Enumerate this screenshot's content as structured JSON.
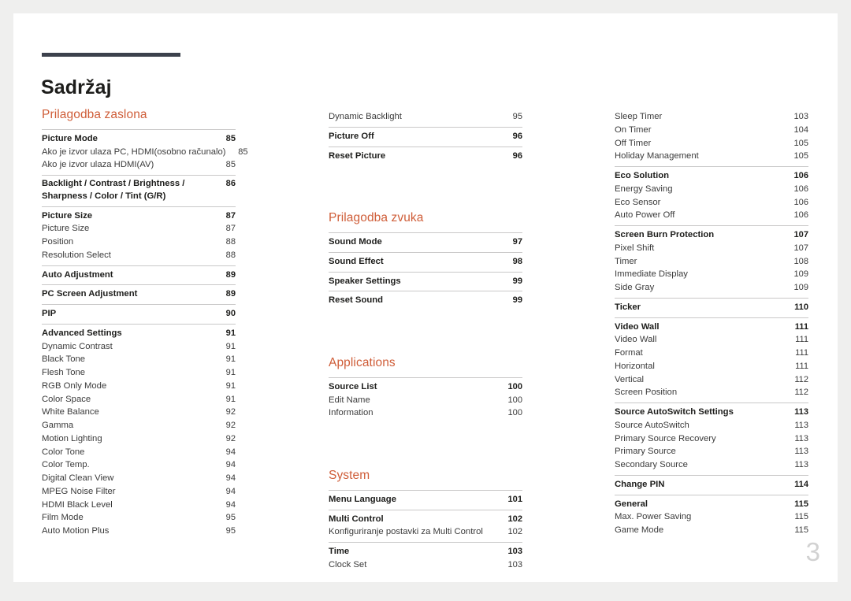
{
  "document": {
    "title": "Sadržaj",
    "folio": "3",
    "accent_color": "#cf5d38",
    "rule_color": "#3c414c",
    "divider_color": "#c9c8c8"
  },
  "columns": [
    {
      "name": "column-1",
      "sections": [
        {
          "heading": "Prilagodba zaslona",
          "groups": [
            {
              "entries": [
                {
                  "label": "Picture Mode",
                  "page": "85",
                  "level": "main"
                },
                {
                  "label": "Ako je izvor ulaza PC, HDMI(osobno računalo)",
                  "page": "85",
                  "level": "sub"
                },
                {
                  "label": "Ako je izvor ulaza HDMI(AV)",
                  "page": "85",
                  "level": "sub"
                }
              ]
            },
            {
              "entries": [
                {
                  "label": "Backlight / Contrast / Brightness / Sharpness / Color / Tint (G/R)",
                  "page": "86",
                  "level": "main-wrap"
                }
              ]
            },
            {
              "entries": [
                {
                  "label": "Picture Size",
                  "page": "87",
                  "level": "main"
                },
                {
                  "label": "Picture Size",
                  "page": "87",
                  "level": "sub"
                },
                {
                  "label": "Position",
                  "page": "88",
                  "level": "sub"
                },
                {
                  "label": "Resolution Select",
                  "page": "88",
                  "level": "sub"
                }
              ]
            },
            {
              "entries": [
                {
                  "label": "Auto Adjustment",
                  "page": "89",
                  "level": "main"
                }
              ]
            },
            {
              "entries": [
                {
                  "label": "PC Screen Adjustment",
                  "page": "89",
                  "level": "main"
                }
              ]
            },
            {
              "entries": [
                {
                  "label": "PIP",
                  "page": "90",
                  "level": "main"
                }
              ]
            },
            {
              "entries": [
                {
                  "label": "Advanced Settings",
                  "page": "91",
                  "level": "main"
                },
                {
                  "label": "Dynamic Contrast",
                  "page": "91",
                  "level": "sub"
                },
                {
                  "label": "Black Tone",
                  "page": "91",
                  "level": "sub"
                },
                {
                  "label": "Flesh Tone",
                  "page": "91",
                  "level": "sub"
                },
                {
                  "label": "RGB Only Mode",
                  "page": "91",
                  "level": "sub"
                },
                {
                  "label": "Color Space",
                  "page": "91",
                  "level": "sub"
                },
                {
                  "label": "White Balance",
                  "page": "92",
                  "level": "sub"
                },
                {
                  "label": "Gamma",
                  "page": "92",
                  "level": "sub"
                },
                {
                  "label": "Motion Lighting",
                  "page": "92",
                  "level": "sub"
                },
                {
                  "label": "Color Tone",
                  "page": "94",
                  "level": "sub"
                },
                {
                  "label": "Color Temp.",
                  "page": "94",
                  "level": "sub"
                },
                {
                  "label": "Digital Clean View",
                  "page": "94",
                  "level": "sub"
                },
                {
                  "label": "MPEG Noise Filter",
                  "page": "94",
                  "level": "sub"
                },
                {
                  "label": "HDMI Black Level",
                  "page": "94",
                  "level": "sub"
                },
                {
                  "label": "Film Mode",
                  "page": "95",
                  "level": "sub"
                },
                {
                  "label": "Auto Motion Plus",
                  "page": "95",
                  "level": "sub"
                }
              ]
            }
          ]
        }
      ]
    },
    {
      "name": "column-2",
      "sections": [
        {
          "heading": "",
          "groups": [
            {
              "no_rule": true,
              "entries": [
                {
                  "label": "Dynamic Backlight",
                  "page": "95",
                  "level": "sub"
                }
              ]
            },
            {
              "entries": [
                {
                  "label": "Picture Off",
                  "page": "96",
                  "level": "main"
                }
              ]
            },
            {
              "entries": [
                {
                  "label": "Reset Picture",
                  "page": "96",
                  "level": "main"
                }
              ]
            }
          ]
        },
        {
          "heading": "Prilagodba zvuka",
          "groups": [
            {
              "entries": [
                {
                  "label": "Sound Mode",
                  "page": "97",
                  "level": "main"
                }
              ]
            },
            {
              "entries": [
                {
                  "label": "Sound Effect",
                  "page": "98",
                  "level": "main"
                }
              ]
            },
            {
              "entries": [
                {
                  "label": "Speaker Settings",
                  "page": "99",
                  "level": "main"
                }
              ]
            },
            {
              "entries": [
                {
                  "label": "Reset Sound",
                  "page": "99",
                  "level": "main"
                }
              ]
            }
          ]
        },
        {
          "heading": "Applications",
          "groups": [
            {
              "entries": [
                {
                  "label": "Source List",
                  "page": "100",
                  "level": "main"
                },
                {
                  "label": "Edit Name",
                  "page": "100",
                  "level": "sub"
                },
                {
                  "label": "Information",
                  "page": "100",
                  "level": "sub"
                }
              ]
            }
          ]
        },
        {
          "heading": "System",
          "groups": [
            {
              "entries": [
                {
                  "label": "Menu Language",
                  "page": "101",
                  "level": "main"
                }
              ]
            },
            {
              "entries": [
                {
                  "label": "Multi Control",
                  "page": "102",
                  "level": "main"
                },
                {
                  "label": "Konfiguriranje postavki za Multi Control",
                  "page": "102",
                  "level": "sub"
                }
              ]
            },
            {
              "entries": [
                {
                  "label": "Time",
                  "page": "103",
                  "level": "main"
                },
                {
                  "label": "Clock Set",
                  "page": "103",
                  "level": "sub"
                }
              ]
            }
          ]
        }
      ]
    },
    {
      "name": "column-3",
      "sections": [
        {
          "heading": "",
          "groups": [
            {
              "no_rule": true,
              "entries": [
                {
                  "label": "Sleep Timer",
                  "page": "103",
                  "level": "sub"
                },
                {
                  "label": "On Timer",
                  "page": "104",
                  "level": "sub"
                },
                {
                  "label": "Off Timer",
                  "page": "105",
                  "level": "sub"
                },
                {
                  "label": "Holiday Management",
                  "page": "105",
                  "level": "sub"
                }
              ]
            },
            {
              "entries": [
                {
                  "label": "Eco Solution",
                  "page": "106",
                  "level": "main"
                },
                {
                  "label": "Energy Saving",
                  "page": "106",
                  "level": "sub"
                },
                {
                  "label": "Eco Sensor",
                  "page": "106",
                  "level": "sub"
                },
                {
                  "label": "Auto Power Off",
                  "page": "106",
                  "level": "sub"
                }
              ]
            },
            {
              "entries": [
                {
                  "label": "Screen Burn Protection",
                  "page": "107",
                  "level": "main"
                },
                {
                  "label": "Pixel Shift",
                  "page": "107",
                  "level": "sub"
                },
                {
                  "label": "Timer",
                  "page": "108",
                  "level": "sub"
                },
                {
                  "label": "Immediate Display",
                  "page": "109",
                  "level": "sub"
                },
                {
                  "label": "Side Gray",
                  "page": "109",
                  "level": "sub"
                }
              ]
            },
            {
              "entries": [
                {
                  "label": "Ticker",
                  "page": "110",
                  "level": "main"
                }
              ]
            },
            {
              "entries": [
                {
                  "label": "Video Wall",
                  "page": "111",
                  "level": "main"
                },
                {
                  "label": "Video Wall",
                  "page": "111",
                  "level": "sub"
                },
                {
                  "label": "Format",
                  "page": "111",
                  "level": "sub"
                },
                {
                  "label": "Horizontal",
                  "page": "111",
                  "level": "sub"
                },
                {
                  "label": "Vertical",
                  "page": "112",
                  "level": "sub"
                },
                {
                  "label": "Screen Position",
                  "page": "112",
                  "level": "sub"
                }
              ]
            },
            {
              "entries": [
                {
                  "label": "Source AutoSwitch Settings",
                  "page": "113",
                  "level": "main"
                },
                {
                  "label": "Source AutoSwitch",
                  "page": "113",
                  "level": "sub"
                },
                {
                  "label": "Primary Source Recovery",
                  "page": "113",
                  "level": "sub"
                },
                {
                  "label": "Primary Source",
                  "page": "113",
                  "level": "sub"
                },
                {
                  "label": "Secondary Source",
                  "page": "113",
                  "level": "sub"
                }
              ]
            },
            {
              "entries": [
                {
                  "label": "Change PIN",
                  "page": "114",
                  "level": "main"
                }
              ]
            },
            {
              "entries": [
                {
                  "label": "General",
                  "page": "115",
                  "level": "main"
                },
                {
                  "label": "Max. Power Saving",
                  "page": "115",
                  "level": "sub"
                },
                {
                  "label": "Game Mode",
                  "page": "115",
                  "level": "sub"
                }
              ]
            }
          ]
        }
      ]
    }
  ]
}
